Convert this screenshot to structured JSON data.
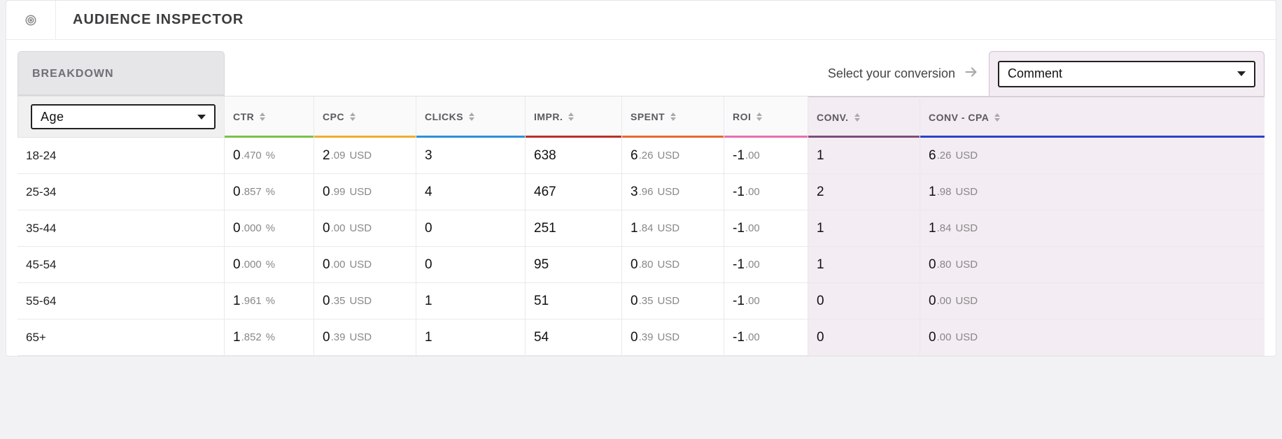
{
  "header": {
    "title": "AUDIENCE INSPECTOR"
  },
  "controls": {
    "breakdown_label": "BREAKDOWN",
    "breakdown_value": "Age",
    "conversion_prompt": "Select your conversion",
    "conversion_value": "Comment"
  },
  "columns": {
    "ctr": "CTR",
    "cpc": "CPC",
    "clicks": "CLICKS",
    "impr": "IMPR.",
    "spent": "SPENT",
    "roi": "ROI",
    "conv": "CONV.",
    "cpa": "CONV - CPA"
  },
  "units": {
    "pct": "%",
    "usd": "USD"
  },
  "rows": [
    {
      "label": "18-24",
      "ctr_int": "0",
      "ctr_dec": ".470",
      "cpc_int": "2",
      "cpc_dec": ".09",
      "clicks": "3",
      "impr": "638",
      "spent_int": "6",
      "spent_dec": ".26",
      "roi_int": "-1",
      "roi_dec": ".00",
      "conv": "1",
      "cpa_int": "6",
      "cpa_dec": ".26"
    },
    {
      "label": "25-34",
      "ctr_int": "0",
      "ctr_dec": ".857",
      "cpc_int": "0",
      "cpc_dec": ".99",
      "clicks": "4",
      "impr": "467",
      "spent_int": "3",
      "spent_dec": ".96",
      "roi_int": "-1",
      "roi_dec": ".00",
      "conv": "2",
      "cpa_int": "1",
      "cpa_dec": ".98"
    },
    {
      "label": "35-44",
      "ctr_int": "0",
      "ctr_dec": ".000",
      "cpc_int": "0",
      "cpc_dec": ".00",
      "clicks": "0",
      "impr": "251",
      "spent_int": "1",
      "spent_dec": ".84",
      "roi_int": "-1",
      "roi_dec": ".00",
      "conv": "1",
      "cpa_int": "1",
      "cpa_dec": ".84"
    },
    {
      "label": "45-54",
      "ctr_int": "0",
      "ctr_dec": ".000",
      "cpc_int": "0",
      "cpc_dec": ".00",
      "clicks": "0",
      "impr": "95",
      "spent_int": "0",
      "spent_dec": ".80",
      "roi_int": "-1",
      "roi_dec": ".00",
      "conv": "1",
      "cpa_int": "0",
      "cpa_dec": ".80"
    },
    {
      "label": "55-64",
      "ctr_int": "1",
      "ctr_dec": ".961",
      "cpc_int": "0",
      "cpc_dec": ".35",
      "clicks": "1",
      "impr": "51",
      "spent_int": "0",
      "spent_dec": ".35",
      "roi_int": "-1",
      "roi_dec": ".00",
      "conv": "0",
      "cpa_int": "0",
      "cpa_dec": ".00"
    },
    {
      "label": "65+",
      "ctr_int": "1",
      "ctr_dec": ".852",
      "cpc_int": "0",
      "cpc_dec": ".39",
      "clicks": "1",
      "impr": "54",
      "spent_int": "0",
      "spent_dec": ".39",
      "roi_int": "-1",
      "roi_dec": ".00",
      "conv": "0",
      "cpa_int": "0",
      "cpa_dec": ".00"
    }
  ],
  "chart_data": {
    "type": "table",
    "breakdown": "Age",
    "columns": [
      "CTR %",
      "CPC USD",
      "CLICKS",
      "IMPR.",
      "SPENT USD",
      "ROI",
      "CONV.",
      "CONV-CPA USD"
    ],
    "categories": [
      "18-24",
      "25-34",
      "35-44",
      "45-54",
      "55-64",
      "65+"
    ],
    "series": [
      {
        "name": "CTR %",
        "values": [
          0.47,
          0.857,
          0.0,
          0.0,
          1.961,
          1.852
        ]
      },
      {
        "name": "CPC USD",
        "values": [
          2.09,
          0.99,
          0.0,
          0.0,
          0.35,
          0.39
        ]
      },
      {
        "name": "CLICKS",
        "values": [
          3,
          4,
          0,
          0,
          1,
          1
        ]
      },
      {
        "name": "IMPR.",
        "values": [
          638,
          467,
          251,
          95,
          51,
          54
        ]
      },
      {
        "name": "SPENT USD",
        "values": [
          6.26,
          3.96,
          1.84,
          0.8,
          0.35,
          0.39
        ]
      },
      {
        "name": "ROI",
        "values": [
          -1.0,
          -1.0,
          -1.0,
          -1.0,
          -1.0,
          -1.0
        ]
      },
      {
        "name": "CONV.",
        "values": [
          1,
          2,
          1,
          1,
          0,
          0
        ]
      },
      {
        "name": "CONV-CPA USD",
        "values": [
          6.26,
          1.98,
          1.84,
          0.8,
          0.0,
          0.0
        ]
      }
    ]
  }
}
